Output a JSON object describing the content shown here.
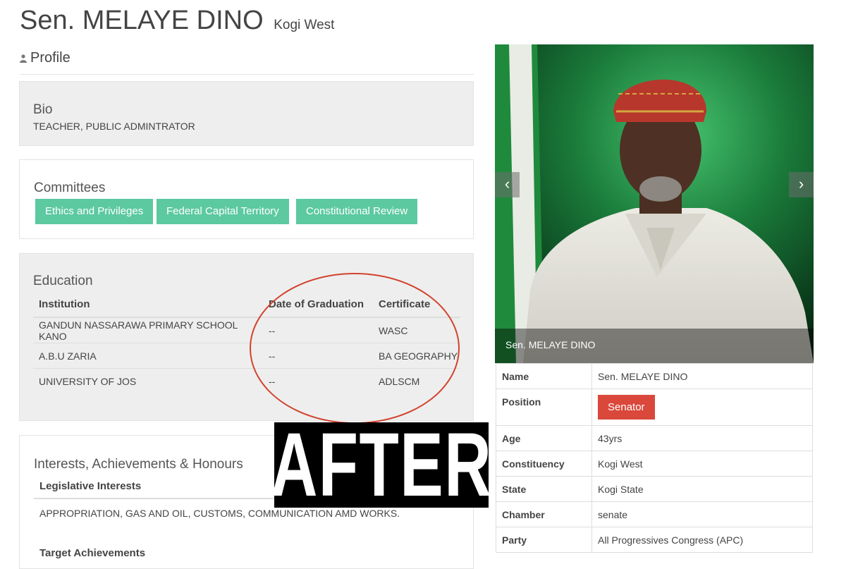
{
  "header": {
    "name": "Sen. MELAYE DINO",
    "constituency": "Kogi West"
  },
  "profile_section": {
    "title": "Profile",
    "icon": "user-icon"
  },
  "bio": {
    "title": "Bio",
    "text": "TEACHER, PUBLIC ADMINTRATOR"
  },
  "committees": {
    "title": "Committees",
    "items": [
      "Ethics and Privileges",
      "Federal Capital Territory",
      "Constitutional Review"
    ],
    "tag_color": "#5cc9a1"
  },
  "education": {
    "title": "Education",
    "columns": [
      "Institution",
      "Date of Graduation",
      "Certificate"
    ],
    "rows": [
      [
        "GANDUN NASSARAWA PRIMARY SCHOOL KANO",
        "--",
        "WASC"
      ],
      [
        "A.B.U ZARIA",
        "--",
        "BA GEOGRAPHY"
      ],
      [
        "UNIVERSITY OF JOS",
        "--",
        "ADLSCM"
      ]
    ],
    "annotation_color": "#d2432e"
  },
  "interests": {
    "title": "Interests, Achievements & Honours",
    "legislative_heading": "Legislative Interests",
    "legislative_text": "APPROPRIATION, GAS AND OIL, CUSTOMS, COMMUNICATION AMD WORKS.",
    "target_heading": "Target Achievements"
  },
  "stamp": {
    "text": "AFTER"
  },
  "photo": {
    "caption": "Sen. MELAYE DINO",
    "prev_icon": "chevron-left-icon",
    "next_icon": "chevron-right-icon",
    "prev_glyph": "‹",
    "next_glyph": "›"
  },
  "info": {
    "name_label": "Name",
    "name_value": "Sen. MELAYE DINO",
    "position_label": "Position",
    "position_value": "Senator",
    "position_color": "#d9483b",
    "age_label": "Age",
    "age_value": "43yrs",
    "constituency_label": "Constituency",
    "constituency_value": "Kogi West",
    "state_label": "State",
    "state_value": "Kogi State",
    "chamber_label": "Chamber",
    "chamber_value": "senate",
    "party_label": "Party",
    "party_value": "All Progressives Congress (APC)"
  }
}
